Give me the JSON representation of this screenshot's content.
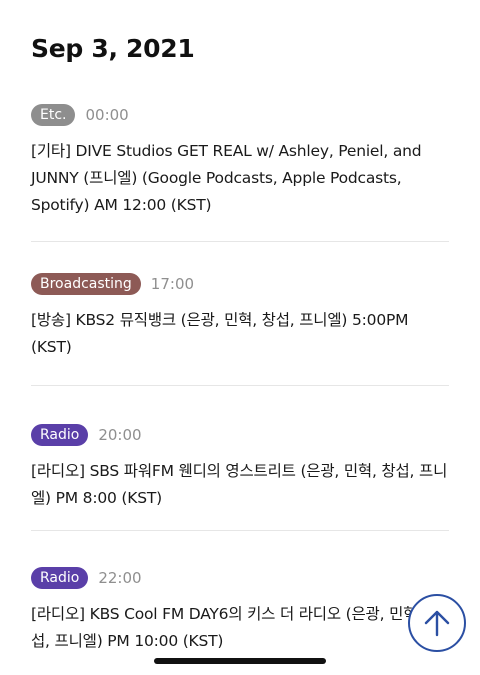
{
  "date_heading": "Sep 3, 2021",
  "events": [
    {
      "category": "Etc.",
      "category_color": "#8e8e8e",
      "time": "00:00",
      "title": "[기타] DIVE Studios GET REAL w/ Ashley, Peniel, and JUNNY (프니엘) (Google Podcasts, Apple Podcasts, Spotify) AM 12:00 (KST)"
    },
    {
      "category": "Broadcasting",
      "category_color": "#8d5a56",
      "time": "17:00",
      "title": "[방송] KBS2 뮤직뱅크 (은광, 민혁, 창섭, 프니엘) 5:00PM (KST)"
    },
    {
      "category": "Radio",
      "category_color": "#5a3fa8",
      "time": "20:00",
      "title": "[라디오] SBS 파워FM 웬디의 영스트리트 (은광, 민혁, 창섭, 프니엘) PM 8:00 (KST)"
    },
    {
      "category": "Radio",
      "category_color": "#5a3fa8",
      "time": "22:00",
      "title": "[라디오] KBS Cool FM DAY6의 키스 더 라디오 (은광, 민혁, 창섭, 프니엘) PM 10:00 (KST)"
    }
  ],
  "scroll_top": {
    "icon": "arrow-up-icon",
    "color": "#2b4fa3"
  }
}
